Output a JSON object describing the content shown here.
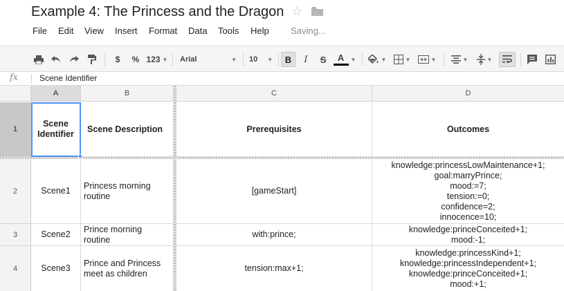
{
  "app": {
    "title": "Example 4: The Princess and the Dragon",
    "status": "Saving..."
  },
  "menu": [
    "File",
    "Edit",
    "View",
    "Insert",
    "Format",
    "Data",
    "Tools",
    "Help"
  ],
  "toolbar": {
    "currency": "$",
    "percent": "%",
    "more_formats": "123",
    "font": "Arial",
    "font_size": "10",
    "bold": "B",
    "italic": "I",
    "strikethrough": "S",
    "text_color_label": "A",
    "text_color": "#000000"
  },
  "formula_bar": {
    "fx": "fx",
    "content": "Scene Identifier"
  },
  "sheet": {
    "columns": [
      "A",
      "B",
      "C",
      "D"
    ],
    "selected_cell": "A1",
    "rows": [
      {
        "num": "1",
        "cells": [
          "Scene\nIdentifier",
          "Scene Description",
          "Prerequisites",
          "Outcomes"
        ]
      },
      {
        "num": "2",
        "cells": [
          "Scene1",
          "Princess morning\nroutine",
          "[gameStart]",
          "knowledge:princessLowMaintenance+1;\ngoal:marryPrince;\nmood:=7;\ntension:=0;\nconfidence=2;\ninnocence=10;"
        ]
      },
      {
        "num": "3",
        "cells": [
          "Scene2",
          "Prince morning\nroutine",
          "with:prince;",
          "knowledge:princeConceited+1;\nmood:-1;"
        ]
      },
      {
        "num": "4",
        "cells": [
          "Scene3",
          "Prince and Princess\nmeet as children",
          "tension:max+1;",
          "knowledge:princessKind+1;\nknowledge:princessIndependent+1;\nknowledge:princeConceited+1;\nmood:+1;"
        ]
      }
    ]
  }
}
